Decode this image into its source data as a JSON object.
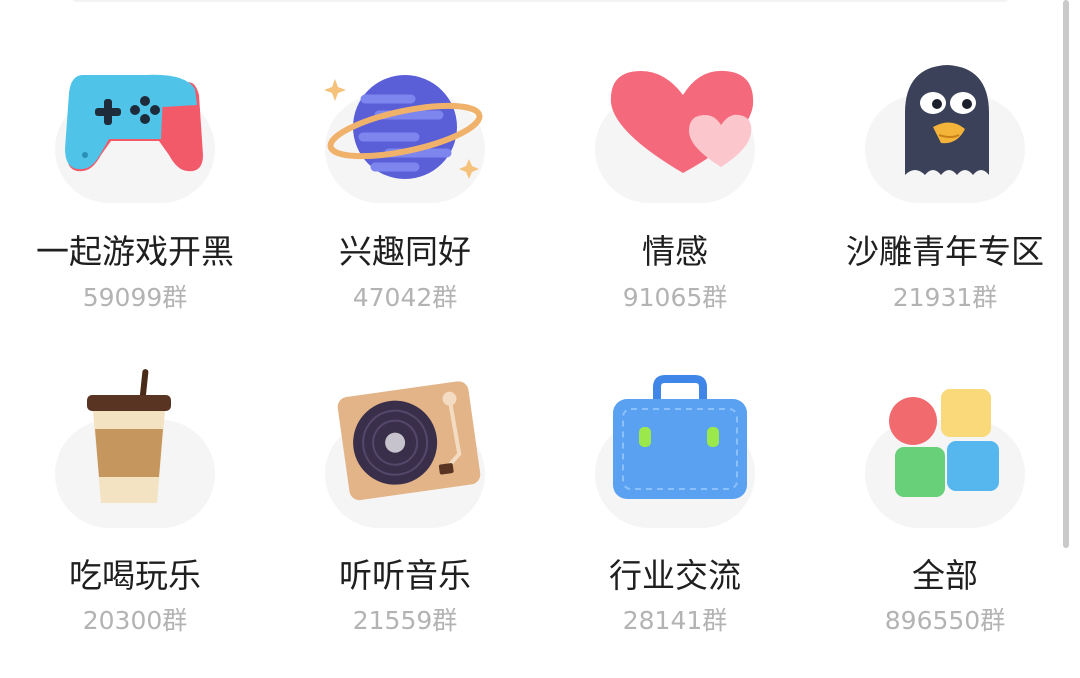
{
  "categories": [
    {
      "label": "一起游戏开黑",
      "count": "59099群",
      "icon": "gamepad-icon"
    },
    {
      "label": "兴趣同好",
      "count": "47042群",
      "icon": "planet-icon"
    },
    {
      "label": "情感",
      "count": "91065群",
      "icon": "hearts-icon"
    },
    {
      "label": "沙雕青年专区",
      "count": "21931群",
      "icon": "ghost-bird-icon"
    },
    {
      "label": "吃喝玩乐",
      "count": "20300群",
      "icon": "coffee-cup-icon"
    },
    {
      "label": "听听音乐",
      "count": "21559群",
      "icon": "record-player-icon"
    },
    {
      "label": "行业交流",
      "count": "28141群",
      "icon": "briefcase-icon"
    },
    {
      "label": "全部",
      "count": "896550群",
      "icon": "app-grid-icon"
    }
  ],
  "colors": {
    "label": "#1f1f1f",
    "count": "#b3b3b3",
    "icon_background": "#f5f5f6"
  }
}
